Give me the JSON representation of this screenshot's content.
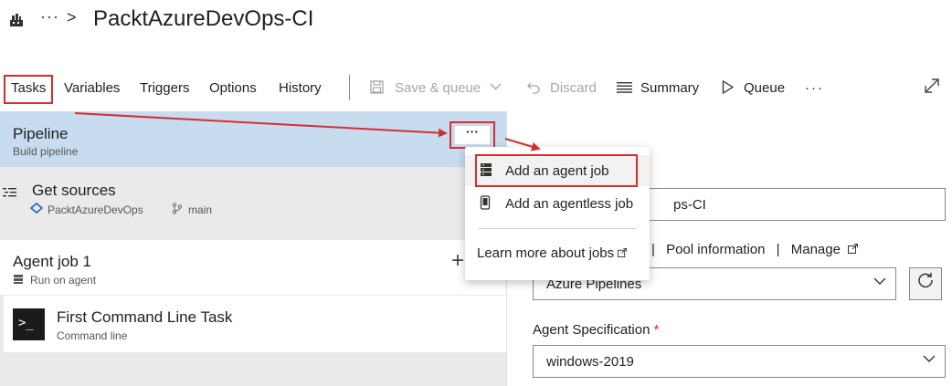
{
  "header": {
    "breadcrumb_more": "···",
    "breadcrumb_sep": ">",
    "title": "PacktAzureDevOps-CI"
  },
  "toolbar": {
    "tabs": [
      "Tasks",
      "Variables",
      "Triggers",
      "Options",
      "History"
    ],
    "save_queue": "Save & queue",
    "discard": "Discard",
    "summary": "Summary",
    "queue": "Queue",
    "more": "···"
  },
  "left": {
    "pipeline": {
      "name": "Pipeline",
      "sub": "Build pipeline",
      "more": "···"
    },
    "sources": {
      "name": "Get sources",
      "repo": "PacktAzureDevOps",
      "branch": "main"
    },
    "job": {
      "name": "Agent job 1",
      "sub": "Run on agent",
      "plus": "+"
    },
    "task": {
      "name": "First Command Line Task",
      "sub": "Command line",
      "tile": ">_"
    }
  },
  "right": {
    "name_value": "ps-CI",
    "links": {
      "pool_information": "Pool information",
      "manage": "Manage"
    },
    "pool_value": "Azure Pipelines",
    "spec_label": "Agent Specification",
    "spec_required": "*",
    "spec_value": "windows-2019"
  },
  "menu": {
    "items": [
      {
        "label": "Add an agent job",
        "icon": "server-icon"
      },
      {
        "label": "Add an agentless job",
        "icon": "phone-icon"
      }
    ],
    "learn_more": "Learn more about jobs"
  },
  "colors": {
    "highlight_box": "#d32f2f",
    "selected_row": "#c7dcef",
    "pane_gray": "#eaeaea"
  }
}
